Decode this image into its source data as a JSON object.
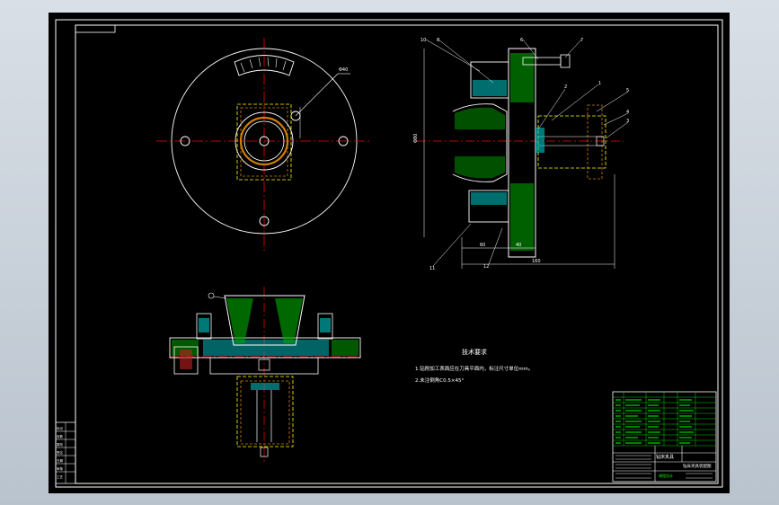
{
  "colors": {
    "background": "#000000",
    "frame": "#ffffff",
    "centerline": "#ff0000",
    "hidden": "#ffff00",
    "section_hatch": "#ffffff",
    "fill_cyan": "#00c8c8",
    "fill_green": "#00a000",
    "fill_orange": "#d08000",
    "dimension": "#ffffff",
    "title_block": "#00ff00"
  },
  "notes": {
    "heading": "技术要求",
    "line1": "1.钻削加工表面应在刀具平面内，标注尺寸单位mm。",
    "line2": "2.未注倒角C0.5×45°"
  },
  "callouts": {
    "n10": "10",
    "n8": "8",
    "n6": "6",
    "n7": "7",
    "n5": "5",
    "n4": "4",
    "n3": "3",
    "n2": "2",
    "n1": "1",
    "n11": "11",
    "n12": "12"
  },
  "dimensions": {
    "overall_width": "160",
    "seg1": "60",
    "seg2": "40",
    "height": "Φ80",
    "plan_label": "Φ40"
  },
  "title_block": {
    "part_name": "钻床夹具",
    "drawing_title": "钻床夹具装配图",
    "school": "课程设计"
  },
  "left_table": {
    "rows": [
      "标记",
      "处数",
      "更改",
      "签名",
      "日期",
      "审核",
      "工艺"
    ]
  }
}
